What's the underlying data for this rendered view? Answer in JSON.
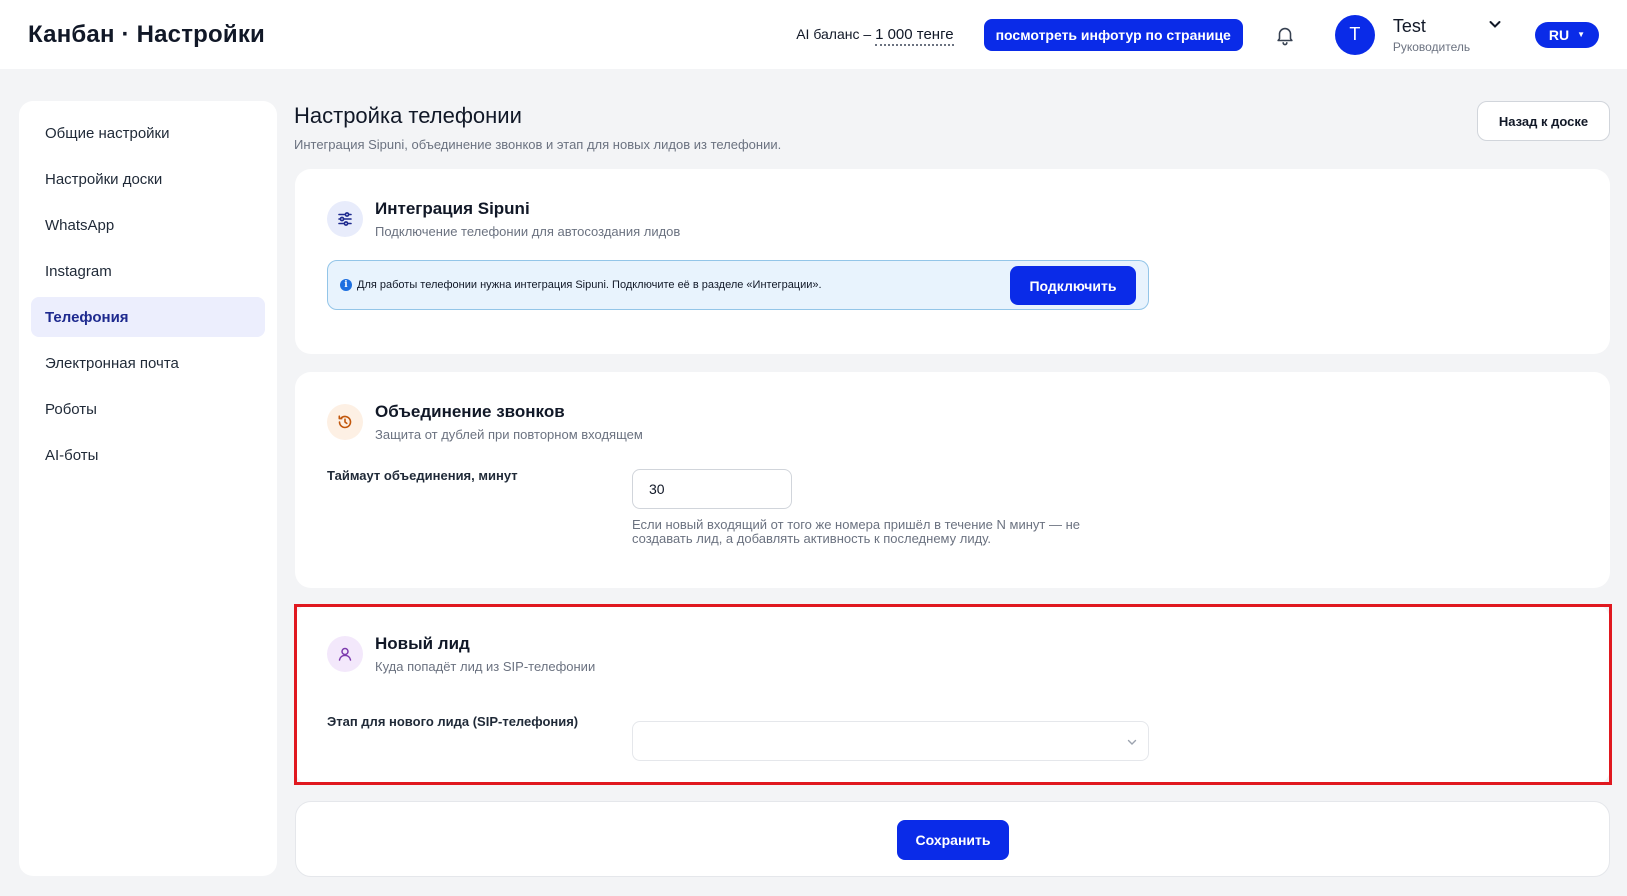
{
  "header": {
    "title": "Канбан · Настройки",
    "ai_balance_label": "AI баланс – ",
    "ai_balance_amount": "1 000 тенге",
    "tour_button": "посмотреть инфотур по странице",
    "user_initial": "T",
    "user_name": "Test",
    "user_role": "Руководитель",
    "language": "RU"
  },
  "sidebar": {
    "items": [
      {
        "label": "Общие настройки"
      },
      {
        "label": "Настройки доски"
      },
      {
        "label": "WhatsApp"
      },
      {
        "label": "Instagram"
      },
      {
        "label": "Телефония",
        "active": true
      },
      {
        "label": "Электронная почта"
      },
      {
        "label": "Роботы"
      },
      {
        "label": "AI-боты"
      }
    ]
  },
  "page": {
    "title": "Настройка телефонии",
    "subtitle": "Интеграция Sipuni, объединение звонков и этап для новых лидов из телефонии.",
    "back_button": "Назад к доске"
  },
  "sipuni": {
    "title": "Интеграция Sipuni",
    "description": "Подключение телефонии для автосоздания лидов",
    "info_text": "Для работы телефонии нужна интеграция Sipuni. Подключите её в разделе «Интеграции».",
    "connect_button": "Подключить",
    "icon": "sliders-icon"
  },
  "merge": {
    "title": "Объединение звонков",
    "description": "Защита от дублей при повторном входящем",
    "timeout_label": "Таймаут объединения, минут",
    "timeout_value": "30",
    "help_text": "Если новый входящий от того же номера пришёл в течение N минут — не создавать лид, а добавлять активность к последнему лиду.",
    "icon": "history-icon"
  },
  "new_lead": {
    "title": "Новый лид",
    "description": "Куда попадёт лид из SIP-телефонии",
    "stage_label": "Этап для нового лида (SIP-телефония)",
    "stage_value": "",
    "icon": "user-icon"
  },
  "footer": {
    "save_button": "Сохранить"
  },
  "colors": {
    "accent": "#0a2be8",
    "highlight": "#e0181f",
    "info_bg": "#e8f3fd"
  }
}
